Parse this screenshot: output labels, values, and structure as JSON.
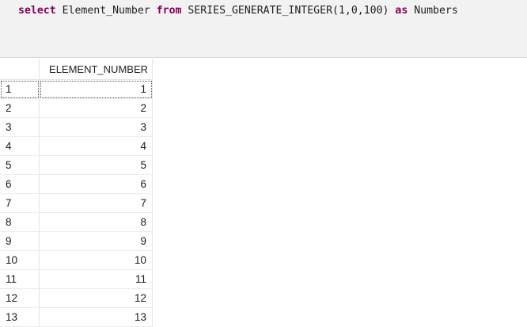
{
  "editor": {
    "tokens": [
      {
        "text": "select",
        "kw": true
      },
      {
        "text": " Element_Number ",
        "kw": false
      },
      {
        "text": "from",
        "kw": true
      },
      {
        "text": " SERIES_GENERATE_INTEGER(1,0,100) ",
        "kw": false
      },
      {
        "text": "as",
        "kw": true
      },
      {
        "text": " Numbers",
        "kw": false
      }
    ]
  },
  "results": {
    "column_header": "ELEMENT_NUMBER",
    "selected_row": 0,
    "rows": [
      {
        "row_number": "1",
        "value": "1"
      },
      {
        "row_number": "2",
        "value": "2"
      },
      {
        "row_number": "3",
        "value": "3"
      },
      {
        "row_number": "4",
        "value": "4"
      },
      {
        "row_number": "5",
        "value": "5"
      },
      {
        "row_number": "6",
        "value": "6"
      },
      {
        "row_number": "7",
        "value": "7"
      },
      {
        "row_number": "8",
        "value": "8"
      },
      {
        "row_number": "9",
        "value": "9"
      },
      {
        "row_number": "10",
        "value": "10"
      },
      {
        "row_number": "11",
        "value": "11"
      },
      {
        "row_number": "12",
        "value": "12"
      },
      {
        "row_number": "13",
        "value": "13"
      }
    ]
  }
}
